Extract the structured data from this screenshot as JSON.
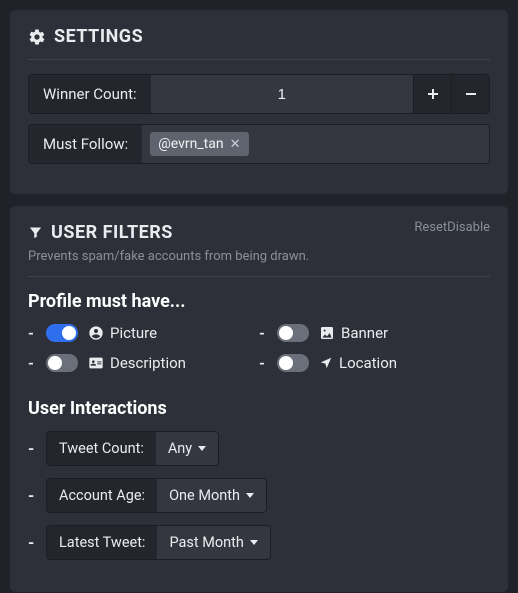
{
  "settings": {
    "title": "SETTINGS",
    "winner_count_label": "Winner Count:",
    "winner_count_value": "1",
    "must_follow_label": "Must Follow:",
    "must_follow_tags": [
      "@evrn_tan"
    ]
  },
  "filters": {
    "title": "USER FILTERS",
    "subtitle": "Prevents spam/fake accounts from being drawn.",
    "reset_label": "Reset",
    "disable_label": "Disable",
    "profile_title": "Profile must have...",
    "profile_items": [
      {
        "label": "Picture",
        "on": true
      },
      {
        "label": "Banner",
        "on": false
      },
      {
        "label": "Description",
        "on": false
      },
      {
        "label": "Location",
        "on": false
      }
    ],
    "interactions_title": "User Interactions",
    "interactions": [
      {
        "label": "Tweet Count:",
        "value": "Any"
      },
      {
        "label": "Account Age:",
        "value": "One Month"
      },
      {
        "label": "Latest Tweet:",
        "value": "Past Month"
      }
    ]
  }
}
